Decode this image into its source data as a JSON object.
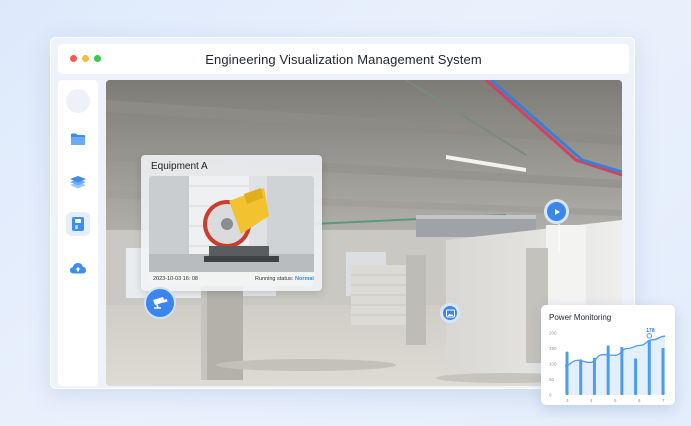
{
  "window": {
    "title": "Engineering Visualization Management System"
  },
  "sidebar": {
    "items": [
      {
        "name": "avatar"
      },
      {
        "name": "folder-icon"
      },
      {
        "name": "layers-icon"
      },
      {
        "name": "device-icon",
        "active": true
      },
      {
        "name": "cloud-icon"
      }
    ]
  },
  "equipment_card": {
    "title": "Equipment A",
    "timestamp": "2023-10-03  16:  08",
    "status_label": "Running status:",
    "status_value": "Normal"
  },
  "power_card": {
    "title": "Power Monitoring",
    "highlight_label": "178"
  },
  "chart_data": {
    "type": "bar",
    "title": "Power Monitoring",
    "categories": [
      "3",
      "4",
      "5",
      "6",
      "7"
    ],
    "yticks": [
      "200",
      "150",
      "100",
      "50",
      "0"
    ],
    "ylim": [
      0,
      200
    ],
    "bars": [
      140,
      115,
      120,
      160,
      155,
      118,
      178,
      152
    ],
    "line": [
      95,
      112,
      105,
      130,
      128,
      150,
      160,
      178,
      190
    ],
    "highlight": {
      "value": 178,
      "label": "178"
    },
    "colors": {
      "bar": "#4d9cf2",
      "line": "#4d9cf2",
      "area": "#dcebfd"
    }
  },
  "colors": {
    "accent": "#3a86ee",
    "status_normal": "#2c8df0"
  }
}
